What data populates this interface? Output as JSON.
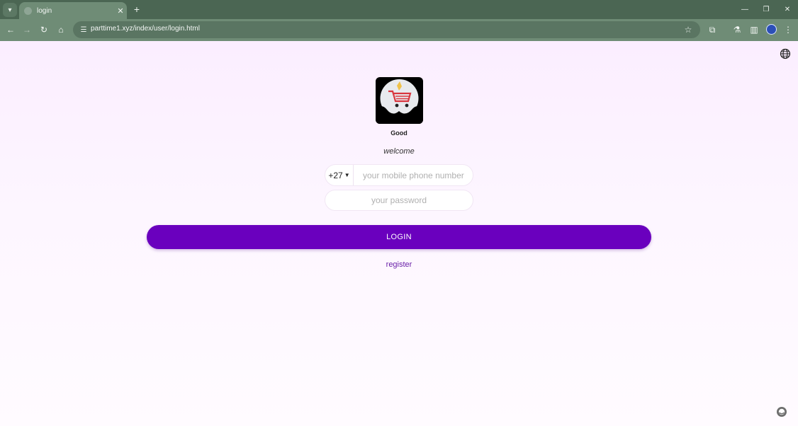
{
  "browser": {
    "tab_title": "login",
    "url": "parttime1.xyz/index/user/login.html"
  },
  "app": {
    "brand": "Good",
    "welcome": "welcome"
  },
  "form": {
    "country_code": "+27",
    "phone_placeholder": "your mobile phone number",
    "password_placeholder": "your password",
    "login_label": "LOGIN",
    "register_label": "register"
  },
  "colors": {
    "primary": "#6a00be",
    "link": "#6a20a8",
    "page_background": "#fbeeff",
    "chrome": "#6f8c76"
  },
  "icons": [
    "globe-icon",
    "support-icon",
    "cart-logo"
  ]
}
